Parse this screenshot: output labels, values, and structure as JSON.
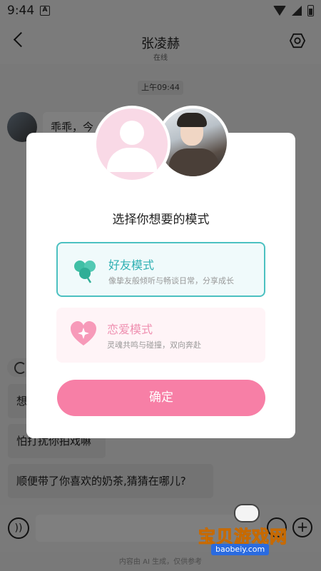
{
  "status_bar": {
    "time": "9:44",
    "app_icon": "A"
  },
  "header": {
    "title": "张凌赫",
    "subtitle": "在线",
    "settings_icon": "hexagon-gear-icon"
  },
  "chat": {
    "time_chip": "上午09:44",
    "ai_bubble_text": "乖乖，今",
    "user_messages": [
      "想",
      "怕打扰你拍戏嘛",
      "顺便带了你喜欢的奶茶,猜猜在哪儿?"
    ]
  },
  "input_bar": {
    "placeholder": "",
    "disclaimer": "内容由 AI 生成，仅供参考"
  },
  "modal": {
    "title": "选择你想要的模式",
    "options": [
      {
        "title": "好友模式",
        "desc": "像挚友般倾听与畅谈日常，分享成长",
        "icon": "clover-icon",
        "selected": true
      },
      {
        "title": "恋爱模式",
        "desc": "灵魂共鸣与碰撞，双向奔赴",
        "icon": "heart-sparkle-icon",
        "selected": false
      }
    ],
    "confirm_label": "确定"
  },
  "watermark": {
    "text": "宝贝游戏网",
    "url": "baobeiy.com"
  },
  "colors": {
    "accent_teal": "#4cc1c1",
    "accent_pink": "#f77fa6",
    "love_bg": "#fff4f7",
    "friend_bg": "#f0fafb"
  }
}
